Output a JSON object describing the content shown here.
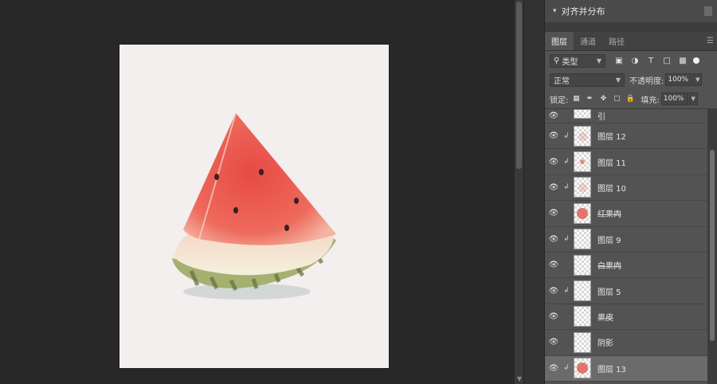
{
  "document": {
    "description_alt": ""
  },
  "align_panel": {
    "title": "对齐并分布"
  },
  "tabs": [
    {
      "label": "图层",
      "active": true
    },
    {
      "label": "通道",
      "active": false
    },
    {
      "label": "路径",
      "active": false
    }
  ],
  "filter": {
    "kind_label": "类型"
  },
  "blend": {
    "mode": "正常",
    "opacity_label": "不透明度:",
    "opacity_value": "100%"
  },
  "lock": {
    "label": "锁定:",
    "fill_label": "填充:",
    "fill_value": "100%"
  },
  "layers": [
    {
      "name": "引",
      "clipped": false,
      "strike": false,
      "thumb": "plain",
      "partial": true
    },
    {
      "name": "图层 12",
      "clipped": true,
      "strike": false,
      "thumb": "faint",
      "partial": false
    },
    {
      "name": "图层 11",
      "clipped": true,
      "strike": false,
      "thumb": "small",
      "partial": false
    },
    {
      "name": "图层 10",
      "clipped": true,
      "strike": false,
      "thumb": "faint",
      "partial": false
    },
    {
      "name": "红果肉",
      "clipped": false,
      "strike": true,
      "thumb": "red",
      "partial": false
    },
    {
      "name": "图层 9",
      "clipped": true,
      "strike": false,
      "thumb": "plain",
      "partial": false
    },
    {
      "name": "白果肉",
      "clipped": false,
      "strike": true,
      "thumb": "plain",
      "partial": false
    },
    {
      "name": "图层 5",
      "clipped": true,
      "strike": false,
      "thumb": "plain",
      "partial": false
    },
    {
      "name": "果皮",
      "clipped": false,
      "strike": true,
      "thumb": "plain",
      "partial": false
    },
    {
      "name": "阴影",
      "clipped": false,
      "strike": false,
      "thumb": "plain",
      "partial": false
    },
    {
      "name": "图层 13",
      "clipped": true,
      "strike": false,
      "thumb": "red",
      "partial": false,
      "selected": true
    }
  ],
  "colors": {
    "panel_bg": "#535353",
    "canvas_bg": "#282828",
    "doc_bg": "#f2efee",
    "flesh": "#e8574f",
    "rind": "#9bab6a"
  }
}
